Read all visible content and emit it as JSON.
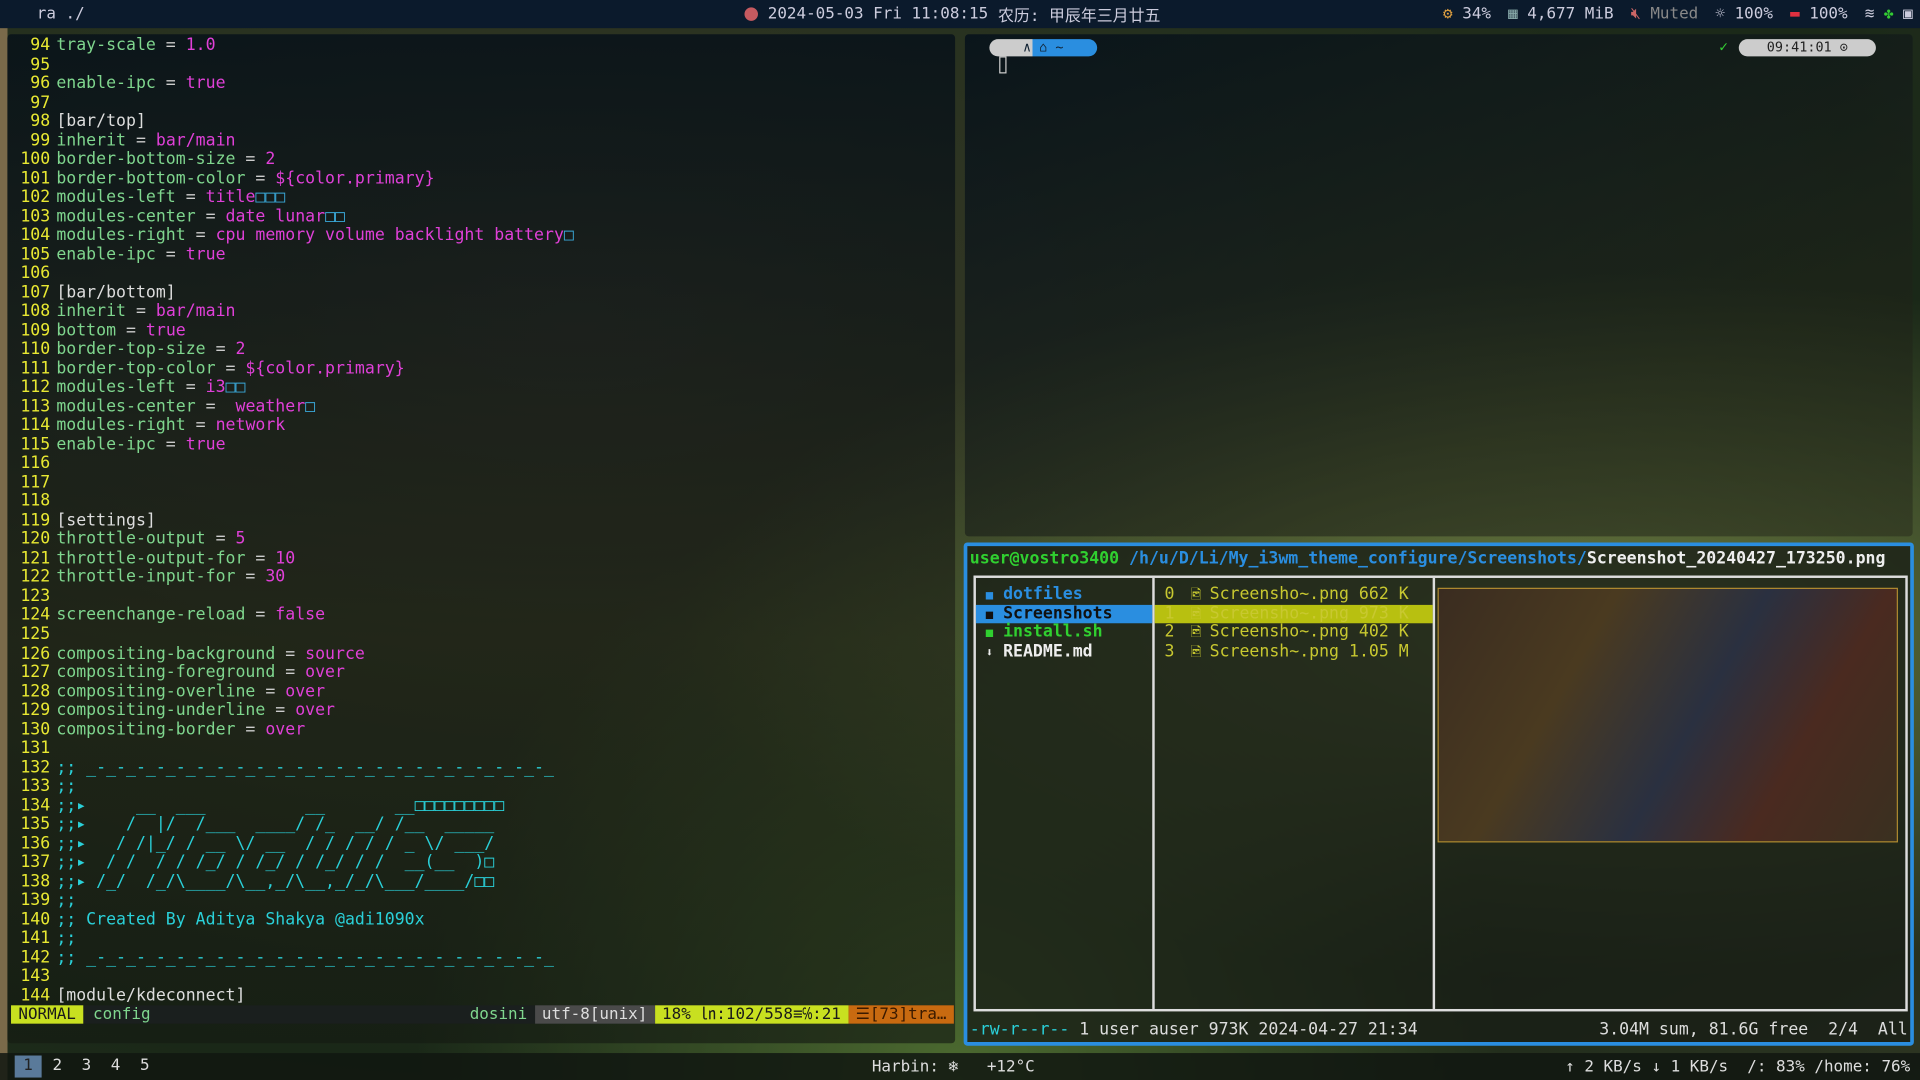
{
  "topbar": {
    "title": "ra ./",
    "datetime": "2024-05-03 Fri 11:08:15",
    "lunar": "农历: 甲辰年三月廿五",
    "cpu": "34%",
    "memory": "4,677 MiB",
    "volume": "Muted",
    "backlight": "100%",
    "battery": "100%"
  },
  "editor": {
    "lines": [
      {
        "n": "94",
        "k": "tray-scale",
        "v": "1.0"
      },
      {
        "n": "95"
      },
      {
        "n": "96",
        "k": "enable-ipc",
        "v": "true"
      },
      {
        "n": "97"
      },
      {
        "n": "98",
        "s": "[bar/top]"
      },
      {
        "n": "99",
        "k": "inherit",
        "v": "bar/main"
      },
      {
        "n": "100",
        "k": "border-bottom-size",
        "v": "2"
      },
      {
        "n": "101",
        "k": "border-bottom-color",
        "v": "${color.primary}"
      },
      {
        "n": "102",
        "k": "modules-left",
        "v": "title",
        "b": "□□□"
      },
      {
        "n": "103",
        "k": "modules-center",
        "v": "date lunar",
        "b": "□□"
      },
      {
        "n": "104",
        "k": "modules-right",
        "v": "cpu memory volume backlight battery",
        "b": "□"
      },
      {
        "n": "105",
        "k": "enable-ipc",
        "v": "true"
      },
      {
        "n": "106"
      },
      {
        "n": "107",
        "s": "[bar/bottom]"
      },
      {
        "n": "108",
        "k": "inherit",
        "v": "bar/main"
      },
      {
        "n": "109",
        "k": "bottom",
        "v": "true"
      },
      {
        "n": "110",
        "k": "border-top-size",
        "v": "2"
      },
      {
        "n": "111",
        "k": "border-top-color",
        "v": "${color.primary}"
      },
      {
        "n": "112",
        "k": "modules-left",
        "v": "i3",
        "b": "□□"
      },
      {
        "n": "113",
        "k": "modules-center",
        "v": " weather",
        "b": "□"
      },
      {
        "n": "114",
        "k": "modules-right",
        "v": "network"
      },
      {
        "n": "115",
        "k": "enable-ipc",
        "v": "true"
      },
      {
        "n": "116"
      },
      {
        "n": "117"
      },
      {
        "n": "118"
      },
      {
        "n": "119",
        "s": "[settings]"
      },
      {
        "n": "120",
        "k": "throttle-output",
        "v": "5"
      },
      {
        "n": "121",
        "k": "throttle-output-for",
        "v": "10"
      },
      {
        "n": "122",
        "k": "throttle-input-for",
        "v": "30"
      },
      {
        "n": "123"
      },
      {
        "n": "124",
        "k": "screenchange-reload",
        "v": "false"
      },
      {
        "n": "125"
      },
      {
        "n": "126",
        "k": "compositing-background",
        "v": "source"
      },
      {
        "n": "127",
        "k": "compositing-foreground",
        "v": "over"
      },
      {
        "n": "128",
        "k": "compositing-overline",
        "v": "over"
      },
      {
        "n": "129",
        "k": "compositing-underline",
        "v": "over"
      },
      {
        "n": "130",
        "k": "compositing-border",
        "v": "over"
      },
      {
        "n": "131"
      },
      {
        "n": "132",
        "c": ";; _-_-_-_-_-_-_-_-_-_-_-_-_-_-_-_-_-_-_-_-_-_-_-_"
      },
      {
        "n": "133",
        "c": ";;"
      },
      {
        "n": "134",
        "c": ";;▸     __  ___          __       __□□□□□□□□□"
      },
      {
        "n": "135",
        "c": ";;▸    /  |/  /___  ____/ /_  __/ /__  _____"
      },
      {
        "n": "136",
        "c": ";;▸   / /|_/ / __ \\/ __  / / / / / _ \\/ ___/"
      },
      {
        "n": "137",
        "c": ";;▸  / /  / / /_/ / /_/ / /_/ / /  __(__  )□"
      },
      {
        "n": "138",
        "c": ";;▸ /_/  /_/\\____/\\__,_/\\__,_/_/\\___/____/□□"
      },
      {
        "n": "139",
        "c": ";;"
      },
      {
        "n": "140",
        "c": ";; Created By Aditya Shakya @adi1090x"
      },
      {
        "n": "141",
        "c": ";;"
      },
      {
        "n": "142",
        "c": ";; _-_-_-_-_-_-_-_-_-_-_-_-_-_-_-_-_-_-_-_-_-_-_-_"
      },
      {
        "n": "143"
      },
      {
        "n": "144",
        "s": "[module/kdeconnect]"
      }
    ],
    "status": {
      "mode": "NORMAL",
      "file": "config",
      "filetype": "dosini",
      "encoding": "utf-8[unix]",
      "position": "18% ㏑:102/558≡℅:21",
      "warning": "☰[73]tra…"
    }
  },
  "widgets": {
    "left": "∧  ⌂ ~",
    "time": "09:41:01 ⊙"
  },
  "ranger": {
    "user": "user@vostro3400",
    "path": "/h/u/D/Li/My_i3wm_theme_configure/Screenshots/",
    "file": "Screenshot_20240427_173250.png",
    "parent": [
      {
        "icon": "■",
        "name": "dotfiles",
        "color": "#2a8ee0"
      },
      {
        "icon": "■",
        "name": "Screenshots",
        "color": "#111",
        "selected": true
      },
      {
        "icon": "■",
        "name": "install.sh",
        "color": "#30d030"
      },
      {
        "icon": "⬇",
        "name": "README.md",
        "color": "#eee"
      }
    ],
    "files": [
      {
        "i": "0",
        "name": "Screensho~.png",
        "size": "662 K"
      },
      {
        "i": "1",
        "name": "Screensho~.png",
        "size": "973 K",
        "selected": true
      },
      {
        "i": "2",
        "name": "Screensho~.png",
        "size": "402 K"
      },
      {
        "i": "3",
        "name": "Screensh~.png",
        "size": "1.05 M"
      }
    ],
    "footer": {
      "perm": "-rw-r--r--",
      "info": " 1 user auser 973K 2024-04-27 21:34",
      "summary": "3.04M sum, 81.6G free  2/4  All"
    }
  },
  "bottombar": {
    "workspaces": [
      "1",
      "2",
      "3",
      "4",
      "5"
    ],
    "weather": "Harbin: ❄   +12°C",
    "network": "↑ 2 KB/s ↓ 1 KB/s  /: 83% /home: 76%"
  }
}
